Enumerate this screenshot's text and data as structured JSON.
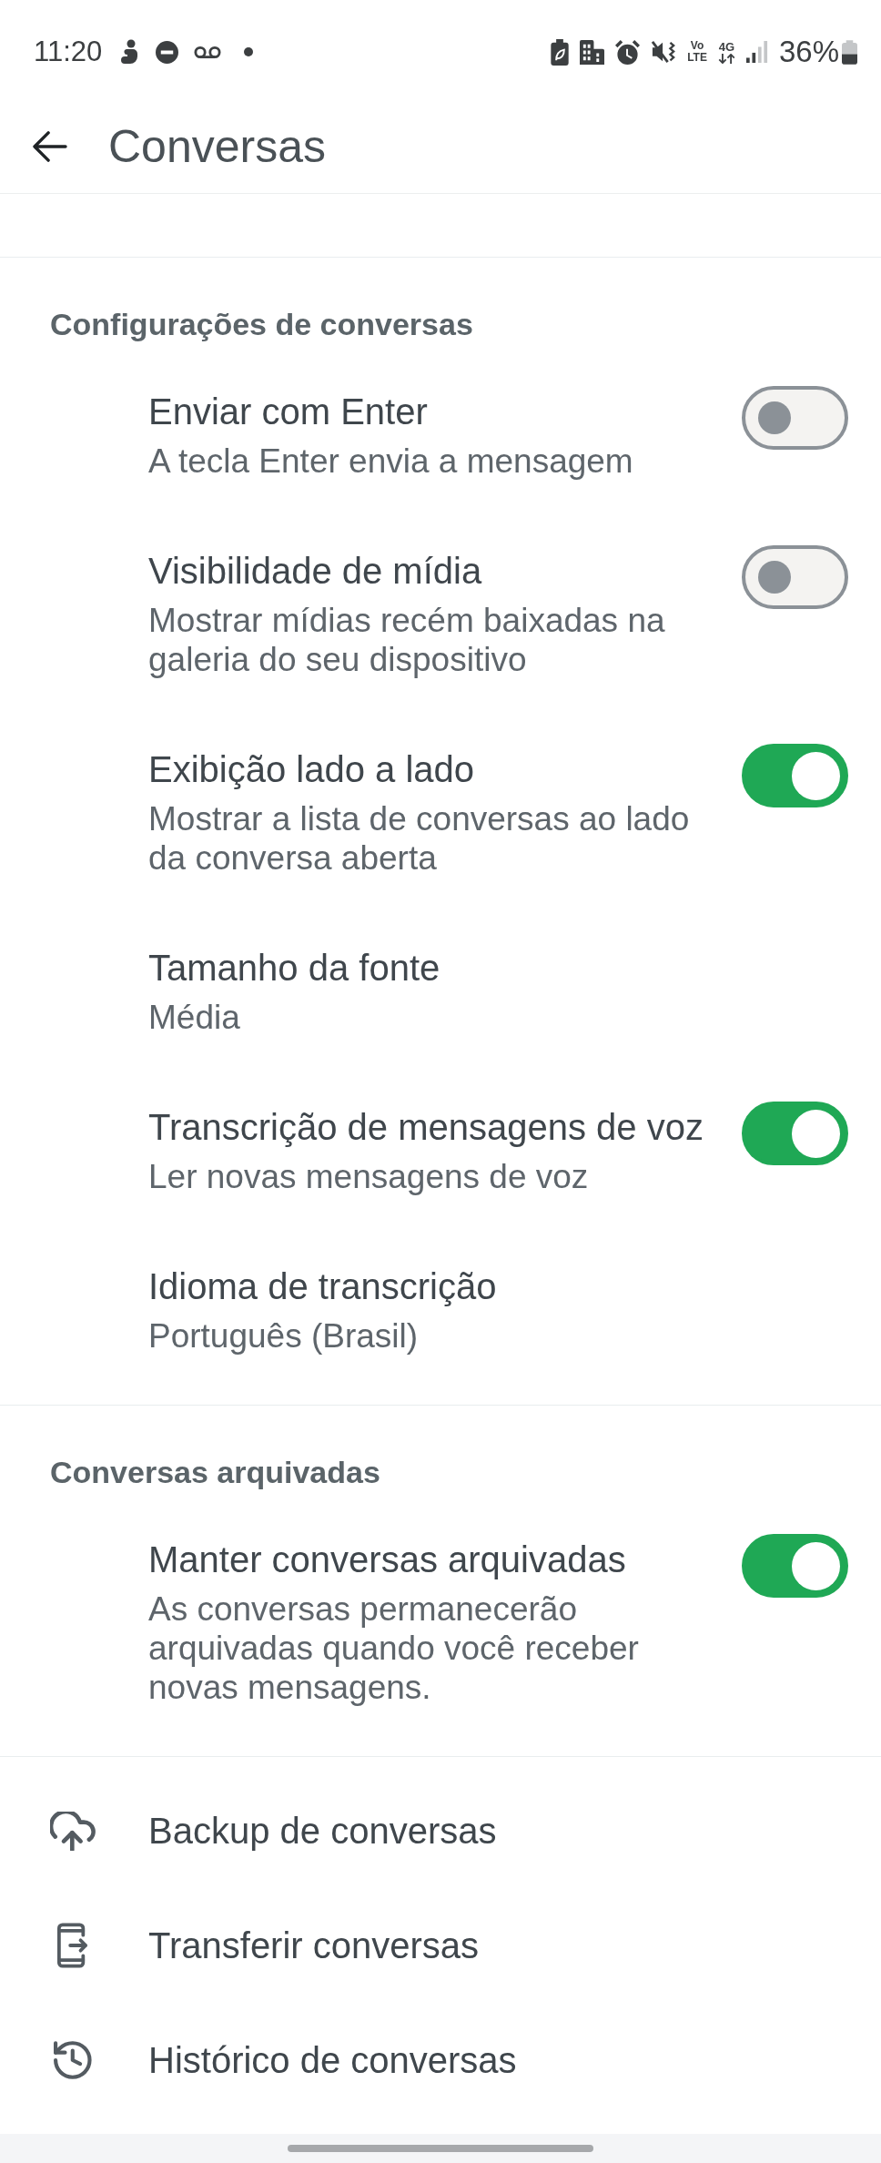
{
  "status_bar": {
    "time": "11:20",
    "volte": [
      "Vo",
      "LTE"
    ],
    "network": "4G",
    "battery": "36%"
  },
  "header": {
    "title": "Conversas"
  },
  "sections": [
    {
      "title": "Configurações de conversas",
      "items": [
        {
          "kind": "toggle",
          "title": "Enviar com Enter",
          "subtitle": "A tecla Enter envia a mensagem",
          "on": false
        },
        {
          "kind": "toggle",
          "title": "Visibilidade de mídia",
          "subtitle": "Mostrar mídias recém baixadas na galeria do seu dispositivo",
          "on": false
        },
        {
          "kind": "toggle",
          "title": "Exibição lado a lado",
          "subtitle": "Mostrar a lista de conversas ao lado da conversa aberta",
          "on": true
        },
        {
          "kind": "value",
          "title": "Tamanho da fonte",
          "subtitle": "Média"
        },
        {
          "kind": "toggle",
          "title": "Transcrição de mensagens de voz",
          "subtitle": "Ler novas mensagens de voz",
          "on": true
        },
        {
          "kind": "value",
          "title": "Idioma de transcrição",
          "subtitle": "Português (Brasil)"
        }
      ]
    },
    {
      "title": "Conversas arquivadas",
      "items": [
        {
          "kind": "toggle",
          "title": "Manter conversas arquivadas",
          "subtitle": "As conversas permanecerão arquivadas quando você receber novas mensagens.",
          "on": true
        }
      ]
    }
  ],
  "links": [
    {
      "label": "Backup de conversas"
    },
    {
      "label": "Transferir conversas"
    },
    {
      "label": "Histórico de conversas"
    }
  ]
}
